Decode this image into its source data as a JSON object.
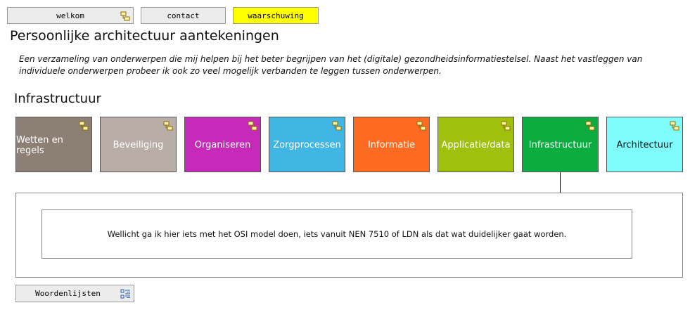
{
  "nav": {
    "welkom": "welkom",
    "contact": "contact",
    "waarschuwing": "waarschuwing"
  },
  "page": {
    "title": "Persoonlijke architectuur aantekeningen",
    "intro": "Een verzameling van onderwerpen die mij helpen bij het beter begrijpen van het (digitale) gezondheidsinformatiestelsel. Naast het vastleggen van individuele onderwerpen probeer ik ook zo veel mogelijk verbanden te leggen tussen onderwerpen."
  },
  "section": {
    "title": "Infrastructuur"
  },
  "tiles": [
    {
      "label": "Wetten en regels",
      "color": "#8c7f74",
      "text_color": "#ffffff"
    },
    {
      "label": "Beveiliging",
      "color": "#b8ada7",
      "text_color": "#ffffff"
    },
    {
      "label": "Organiseren",
      "color": "#c52ab9",
      "text_color": "#ffffff"
    },
    {
      "label": "Zorgprocessen",
      "color": "#3fb6e3",
      "text_color": "#ffffff"
    },
    {
      "label": "Informatie",
      "color": "#fc6b21",
      "text_color": "#ffffff"
    },
    {
      "label": "Applicatie/data",
      "color": "#a0c10c",
      "text_color": "#ffffff"
    },
    {
      "label": "Infrastructuur",
      "color": "#0bad40",
      "text_color": "#ffffff"
    },
    {
      "label": "Architectuur",
      "color": "#7ffdfd",
      "text_color": "#111111"
    }
  ],
  "note": {
    "text": "Wellicht ga ik hier iets met het OSI model doen, iets vanuit NEN 7510 of LDN als dat wat duidelijker gaat worden."
  },
  "footer": {
    "woordenlijsten": "Woordenlijsten"
  },
  "icons": {
    "model_link": "model-link-icon",
    "list": "list-icon"
  }
}
